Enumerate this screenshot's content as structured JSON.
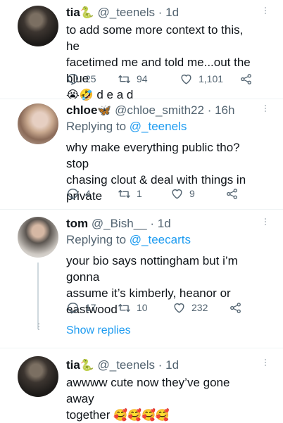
{
  "tweets": [
    {
      "name": "tia",
      "name_emoji": "🐍",
      "handle": "@_teenels",
      "time": "1d",
      "lines": [
        "to add some more context to this, he",
        "facetimed me and told me...out the blue"
      ],
      "emoji_line": "😭🤣",
      "emoji_tail": " d e a d",
      "replies": "25",
      "retweets": "94",
      "likes": "1,101"
    },
    {
      "name": "chloe",
      "name_emoji": "🦋",
      "handle": "@chloe_smith22",
      "time": "16h",
      "replying_prefix": "Replying to",
      "replying_to": "@_teenels",
      "lines": [
        "why make everything public tho? stop",
        "chasing clout & deal with things in",
        "private"
      ],
      "replies": "4",
      "retweets": "1",
      "likes": "9"
    },
    {
      "name": "tom",
      "handle": "@_Bish__",
      "time": "1d",
      "replying_prefix": "Replying to",
      "replying_to": "@_teecarts",
      "lines": [
        "your bio says nottingham but i’m gonna",
        "assume it’s kimberly, heanor or",
        "eastwood"
      ],
      "replies": "17",
      "retweets": "10",
      "likes": "232",
      "show_replies": "Show replies"
    },
    {
      "name": "tia",
      "name_emoji": "🐍",
      "handle": "@_teenels",
      "time": "1d",
      "lines": [
        "awwww cute now they’ve gone away"
      ],
      "last_line": "together",
      "last_emoji": "🥰🥰🥰🥰"
    }
  ],
  "icons": {
    "reply": "reply-icon",
    "retweet": "retweet-icon",
    "like": "heart-icon",
    "share": "share-icon",
    "more": "more-icon"
  },
  "colors": {
    "link": "#1d9bf0",
    "secondary": "#536471",
    "text": "#0f1419"
  }
}
